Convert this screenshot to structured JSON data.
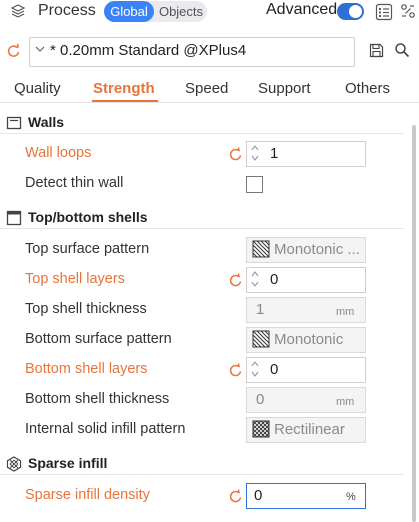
{
  "header": {
    "title": "Process",
    "toggle_global": "Global",
    "toggle_objects": "Objects",
    "advanced_label": "Advanced",
    "advanced_on": true
  },
  "preset": {
    "name": "* 0.20mm Standard @XPlus4"
  },
  "tabs": [
    "Quality",
    "Strength",
    "Speed",
    "Support",
    "Others"
  ],
  "active_tab": "Strength",
  "colors": {
    "accent": "#e8743b",
    "primary_blue": "#2f6fd6"
  },
  "sections": {
    "walls": {
      "title": "Walls",
      "wall_loops": {
        "label": "Wall loops",
        "value": "1"
      },
      "detect_thin_wall": {
        "label": "Detect thin wall",
        "checked": false
      }
    },
    "top_bottom": {
      "title": "Top/bottom shells",
      "top_surface_pattern": {
        "label": "Top surface pattern",
        "value": "Monotonic ..."
      },
      "top_shell_layers": {
        "label": "Top shell layers",
        "value": "0"
      },
      "top_shell_thickness": {
        "label": "Top shell thickness",
        "value": "1",
        "unit": "mm"
      },
      "bottom_surface_pattern": {
        "label": "Bottom surface pattern",
        "value": "Monotonic"
      },
      "bottom_shell_layers": {
        "label": "Bottom shell layers",
        "value": "0"
      },
      "bottom_shell_thickness": {
        "label": "Bottom shell thickness",
        "value": "0",
        "unit": "mm"
      },
      "internal_solid_infill_pattern": {
        "label": "Internal solid infill pattern",
        "value": "Rectilinear"
      }
    },
    "sparse_infill": {
      "title": "Sparse infill",
      "density": {
        "label": "Sparse infill density",
        "value": "0",
        "unit": "%"
      }
    }
  }
}
